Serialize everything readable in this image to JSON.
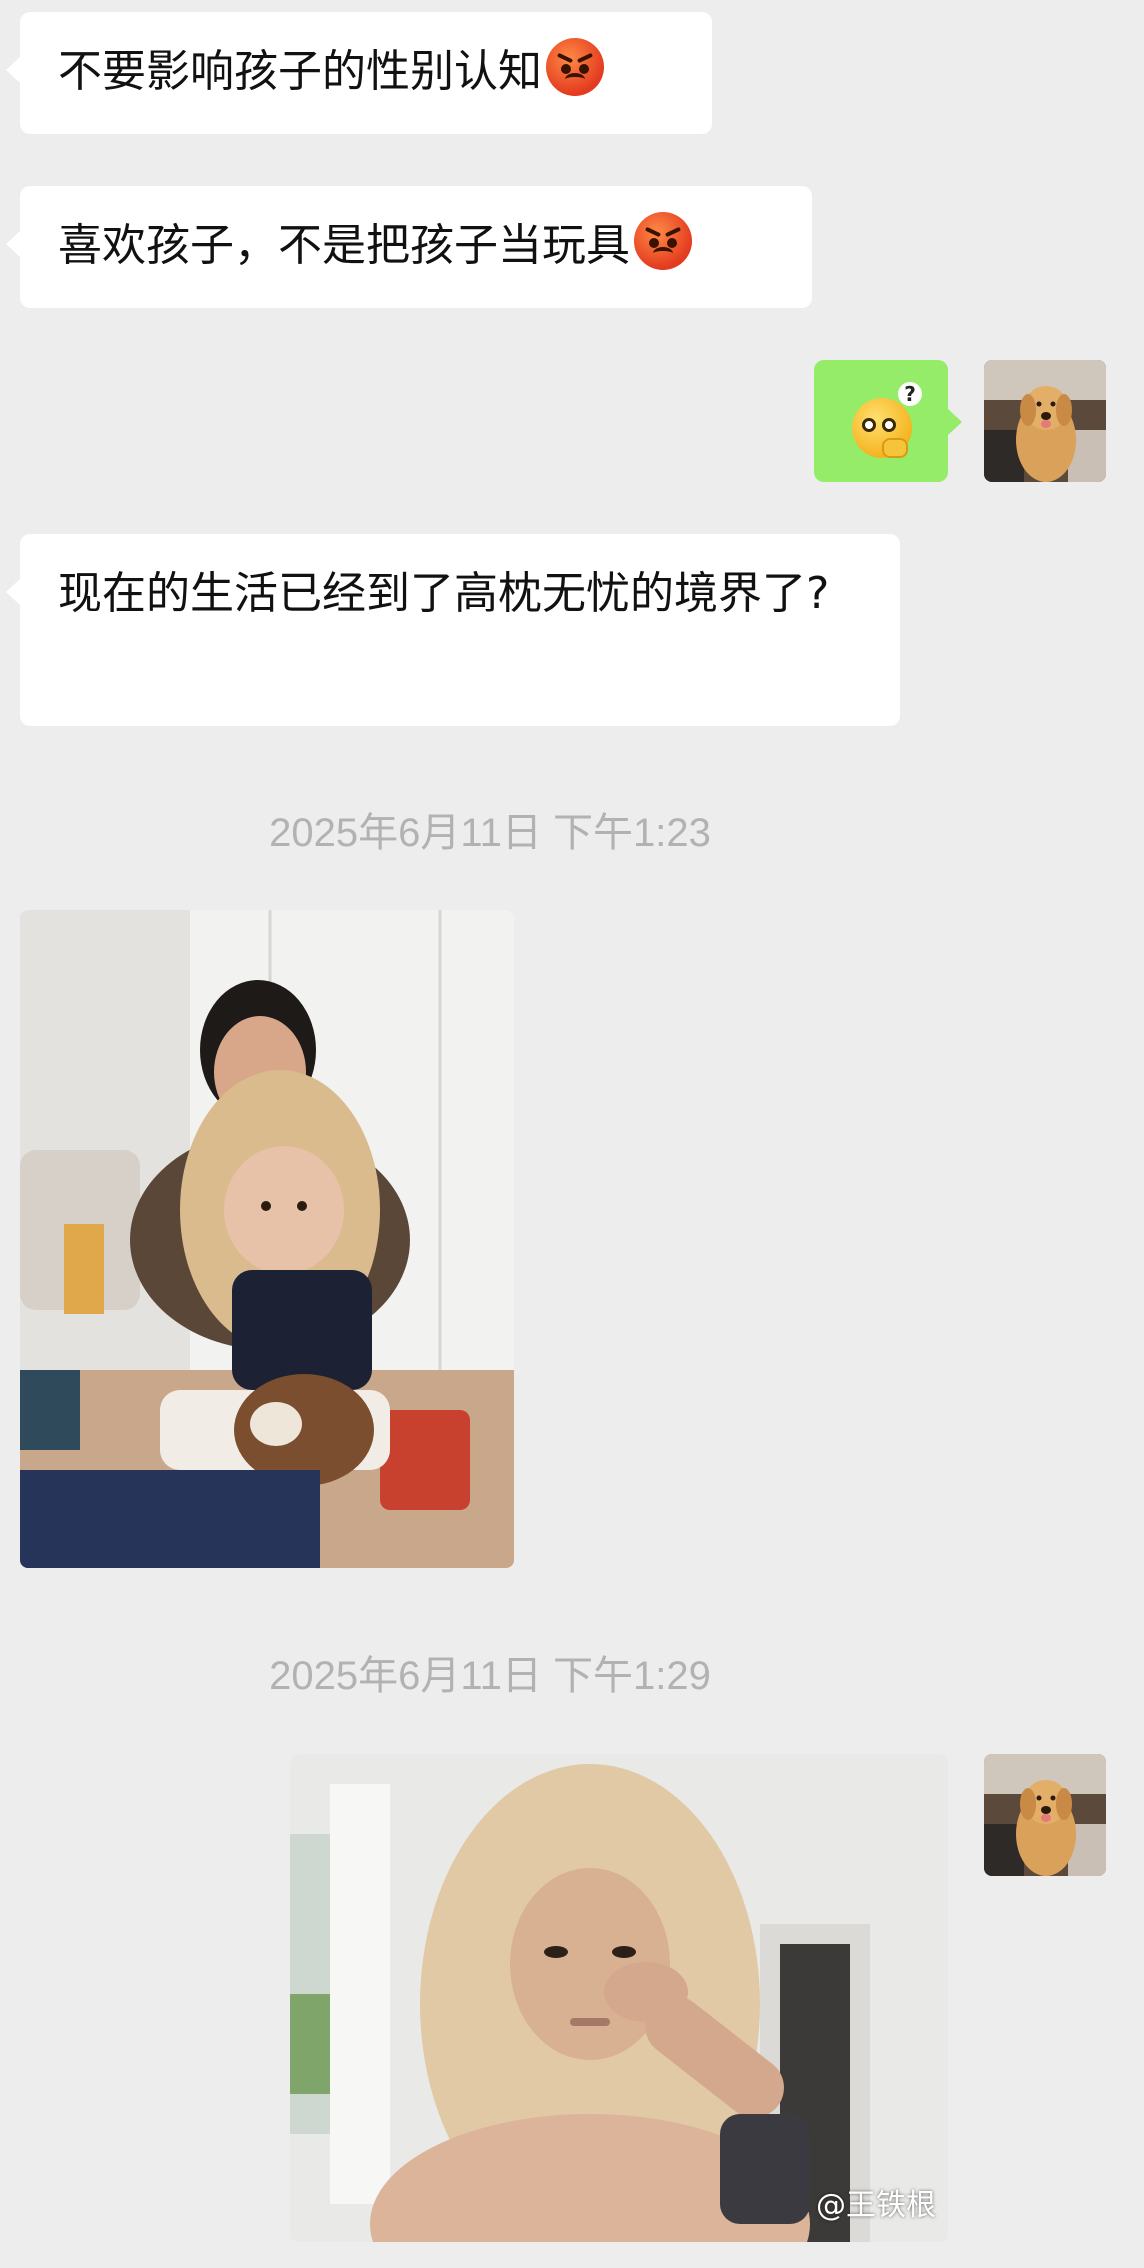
{
  "messages": [
    {
      "text": "不要影响孩子的性别认知",
      "emoji": "angry-face-icon"
    },
    {
      "text": "喜欢孩子，不是把孩子当玩具",
      "emoji": "angry-face-icon"
    },
    {
      "sticker": "thinking-face-question-icon"
    },
    {
      "text": "现在的生活已经到了高枕无忧的境界了?"
    }
  ],
  "timestamps": [
    "2025年6月11日 下午1:23",
    "2025年6月11日 下午1:29"
  ],
  "watermark": "@王铁根",
  "colors": {
    "background": "#ededed",
    "incoming_bubble": "#ffffff",
    "outgoing_bubble": "#95ec69",
    "timestamp": "#b2b2b2"
  }
}
